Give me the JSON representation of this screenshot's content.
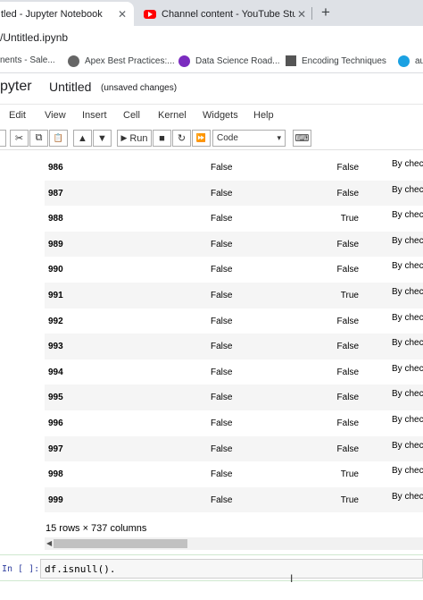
{
  "browser": {
    "active_tab": "tled - Jupyter Notebook",
    "inactive_tab": "Channel content - YouTube Studi",
    "close_glyph": "✕",
    "new_tab_glyph": "+",
    "url": "/Untitled.ipynb",
    "bookmarks": [
      {
        "label": "nents - Sale...",
        "color": ""
      },
      {
        "label": "Apex Best Practices:...",
        "color": "#666666"
      },
      {
        "label": "Data Science Road...",
        "color": "#7b2cbf"
      },
      {
        "label": "Encoding Techniques",
        "color": "#555555"
      },
      {
        "label": "au",
        "color": "#1ba1e2"
      }
    ]
  },
  "jupyter": {
    "logo_text": "pyter",
    "notebook_title": "Untitled",
    "save_status": "(unsaved changes)",
    "menu": [
      "Edit",
      "View",
      "Insert",
      "Cell",
      "Kernel",
      "Widgets",
      "Help"
    ],
    "toolbar": {
      "run_label": "Run",
      "cell_type": "Code",
      "glyphs": {
        "cut": "✂",
        "copy": "⧉",
        "paste": "📋",
        "up": "▲",
        "down": "▼",
        "run": "▶",
        "stop": "■",
        "restart": "↻",
        "fast_forward": "⏩",
        "keyboard": "⌨",
        "chevron": "▾"
      }
    }
  },
  "table": {
    "rows": [
      {
        "idx": "986",
        "a": "False",
        "b": "False",
        "c": "By check"
      },
      {
        "idx": "987",
        "a": "False",
        "b": "False",
        "c": "By check"
      },
      {
        "idx": "988",
        "a": "False",
        "b": "True",
        "c": "By check"
      },
      {
        "idx": "989",
        "a": "False",
        "b": "False",
        "c": "By check"
      },
      {
        "idx": "990",
        "a": "False",
        "b": "False",
        "c": "By check"
      },
      {
        "idx": "991",
        "a": "False",
        "b": "True",
        "c": "By check"
      },
      {
        "idx": "992",
        "a": "False",
        "b": "False",
        "c": "By check"
      },
      {
        "idx": "993",
        "a": "False",
        "b": "False",
        "c": "By check"
      },
      {
        "idx": "994",
        "a": "False",
        "b": "False",
        "c": "By check"
      },
      {
        "idx": "995",
        "a": "False",
        "b": "False",
        "c": "By check"
      },
      {
        "idx": "996",
        "a": "False",
        "b": "False",
        "c": "By check"
      },
      {
        "idx": "997",
        "a": "False",
        "b": "False",
        "c": "By check"
      },
      {
        "idx": "998",
        "a": "False",
        "b": "True",
        "c": "By check"
      },
      {
        "idx": "999",
        "a": "False",
        "b": "True",
        "c": "By check"
      }
    ],
    "summary": "15 rows × 737 columns",
    "scroll_left_glyph": "◀"
  },
  "input_cell": {
    "prompt": "In [ ]:",
    "code": "df.isnull().",
    "cursor_glyph": "I"
  }
}
